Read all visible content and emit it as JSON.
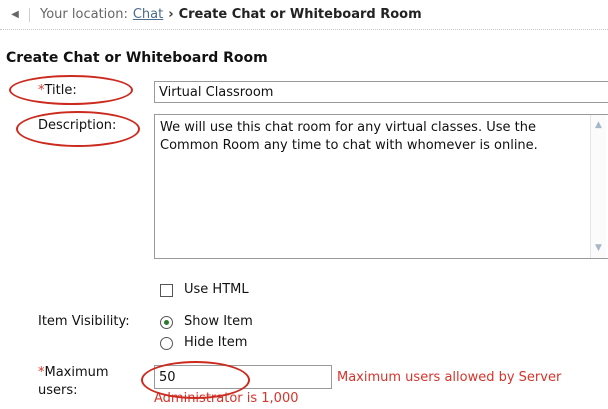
{
  "breadcrumb": {
    "prefix": "Your location:",
    "link": "Chat",
    "separator": "›",
    "current": "Create Chat or Whiteboard Room"
  },
  "page_title": "Create Chat or Whiteboard Room",
  "form": {
    "title": {
      "required_marker": "*",
      "label": "Title:",
      "value": "Virtual Classroom"
    },
    "description": {
      "label": "Description:",
      "value": "We will use this chat room for any virtual classes. Use the Common Room any time to chat with whomever is online."
    },
    "use_html": {
      "label": "Use HTML",
      "checked": false
    },
    "item_visibility": {
      "label": "Item Visibility:",
      "options": [
        {
          "label": "Show Item",
          "checked": true
        },
        {
          "label": "Hide Item",
          "checked": false
        }
      ]
    },
    "max_users": {
      "required_marker": "*",
      "label_line1": "Maximum",
      "label_line2": "users:",
      "value": "50",
      "hint_line1": "Maximum users allowed by Server",
      "hint_line2": "Administrator is 1,000"
    }
  },
  "colors": {
    "required": "#d6342b",
    "annotation": "#cc2a1e",
    "link": "#4a6b8f",
    "radio_selected": "#2b7a2b"
  },
  "icons": {
    "back": "chevron-left-icon",
    "scroll_up": "chevron-up-icon",
    "scroll_down": "chevron-down-icon"
  }
}
